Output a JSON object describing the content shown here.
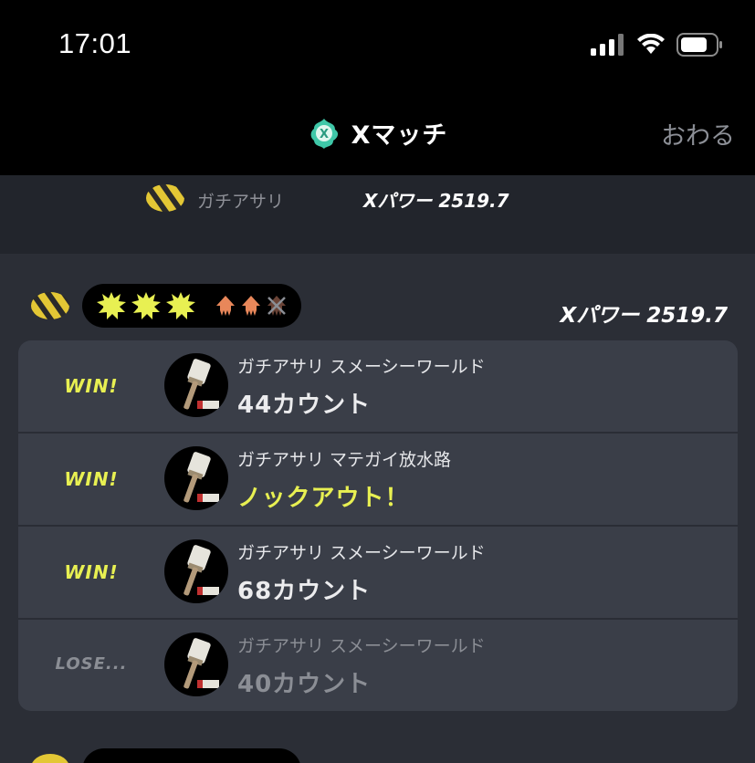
{
  "status": {
    "time": "17:01"
  },
  "nav": {
    "title": "Xマッチ",
    "close_label": "おわる"
  },
  "summary": {
    "rule": "ガチアサリ",
    "power": "Xパワー 2519.7"
  },
  "set": {
    "power": "Xパワー 2519.7"
  },
  "battles": [
    {
      "result": "WIN!",
      "stage": "ガチアサリ スメーシーワールド",
      "score": "44カウント"
    },
    {
      "result": "WIN!",
      "stage": "ガチアサリ マテガイ放水路",
      "score": "ノックアウト！"
    },
    {
      "result": "WIN!",
      "stage": "ガチアサリ スメーシーワールド",
      "score": "68カウント"
    },
    {
      "result": "LOSE...",
      "stage": "ガチアサリ スメーシーワールド",
      "score": "40カウント"
    }
  ],
  "colors": {
    "win": "#e8f052",
    "lose": "#8b8e95",
    "accent": "#3fc7a8",
    "squid": "#e8875a"
  }
}
